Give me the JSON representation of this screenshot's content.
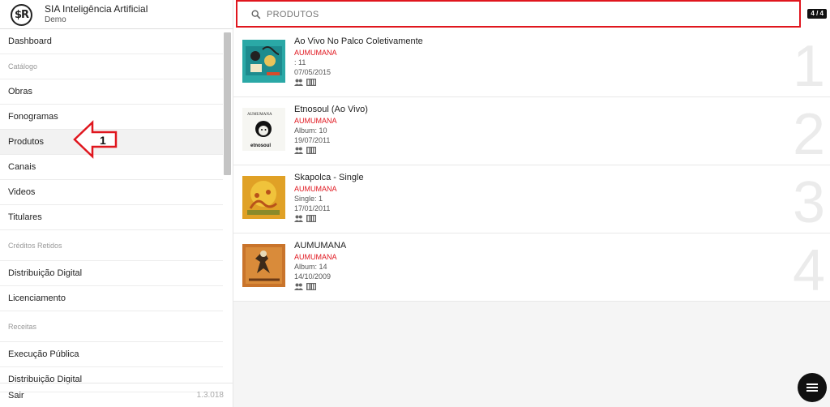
{
  "brand": {
    "title": "SIA Inteligência Artificial",
    "subtitle": "Demo",
    "logo_text": "$R"
  },
  "menu": [
    {
      "label": "Dashboard",
      "type": "item"
    },
    {
      "label": "Catálogo",
      "type": "section"
    },
    {
      "label": "Obras",
      "type": "item"
    },
    {
      "label": "Fonogramas",
      "type": "item"
    },
    {
      "label": "Produtos",
      "type": "item",
      "active": true
    },
    {
      "label": "Canais",
      "type": "item"
    },
    {
      "label": "Videos",
      "type": "item"
    },
    {
      "label": "Titulares",
      "type": "item"
    },
    {
      "label": "Créditos Retidos",
      "type": "section"
    },
    {
      "label": "Distribuição Digital",
      "type": "item"
    },
    {
      "label": "Licenciamento",
      "type": "item"
    },
    {
      "label": "Receitas",
      "type": "section"
    },
    {
      "label": "Execução Pública",
      "type": "item"
    },
    {
      "label": "Distribuição Digital",
      "type": "item"
    }
  ],
  "footer": {
    "logout": "Sair",
    "version": "1.3.018"
  },
  "annotation": {
    "number": "1"
  },
  "search": {
    "placeholder": "PRODUTOS",
    "counter": "4 / 4"
  },
  "results": [
    {
      "title": "Ao Vivo No Palco Coletivamente",
      "artist": "AUMUMANA",
      "meta": ": 11",
      "date": "07/05/2015",
      "num": "1"
    },
    {
      "title": "Etnosoul (Ao Vivo)",
      "artist": "AUMUMANA",
      "meta": "Album: 10",
      "date": "19/07/2011",
      "num": "2"
    },
    {
      "title": "Skapolca - Single",
      "artist": "AUMUMANA",
      "meta": "Single: 1",
      "date": "17/01/2011",
      "num": "3"
    },
    {
      "title": "AUMUMANA",
      "artist": "AUMUMANA",
      "meta": "Album: 14",
      "date": "14/10/2009",
      "num": "4"
    }
  ],
  "colors": {
    "accent": "#e0161e",
    "fab": "#111111"
  },
  "icons": {
    "search": "search-icon",
    "people": "people-icon",
    "barcode": "barcode-icon",
    "fab": "menu-icon"
  }
}
